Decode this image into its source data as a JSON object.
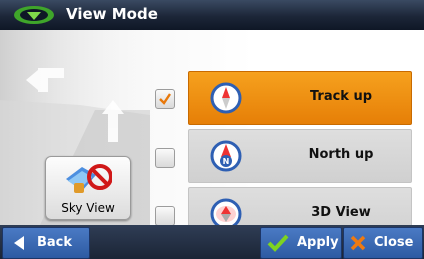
{
  "titlebar": {
    "title": "View Mode",
    "logo_icon": "navigation-logo-icon"
  },
  "sky_view": {
    "label": "Sky View",
    "icon": "sky-view-disabled-icon"
  },
  "options": [
    {
      "label": "Track up",
      "checked": true,
      "icon": "compass-track-up-icon"
    },
    {
      "label": "North up",
      "checked": false,
      "icon": "compass-north-up-icon"
    },
    {
      "label": "3D View",
      "checked": false,
      "icon": "compass-3d-view-icon"
    }
  ],
  "bottom": {
    "back": "Back",
    "apply": "Apply",
    "close": "Close"
  },
  "colors": {
    "selected": "#f39a1a",
    "unselected": "#d8d8d8",
    "button": "#3b69b4",
    "titlebar": "#1c2638"
  }
}
